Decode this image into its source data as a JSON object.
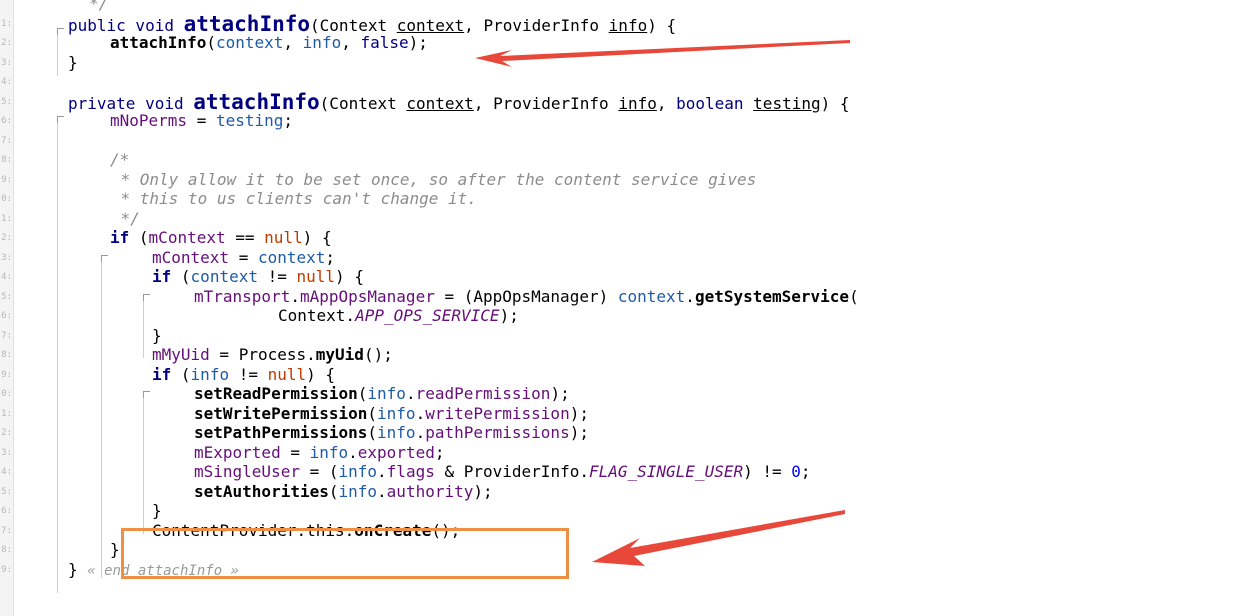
{
  "gutter": {
    "line_numbers": [
      "",
      "1:",
      "2:",
      "3:",
      "4:",
      "5:",
      "6:",
      "7:",
      "8:",
      "9:",
      "0:",
      "1:",
      "2:",
      "3:",
      "4:",
      "5:",
      "6:",
      "7:",
      "8:",
      "9:",
      "0:",
      "1:",
      "2:",
      "3:",
      "4:",
      "5:",
      "6:",
      "7:",
      "8:",
      "9:"
    ]
  },
  "editor": {
    "lines": [
      {
        "indent": 2,
        "tokens": [
          {
            "t": "*/",
            "c": "cmt"
          }
        ]
      },
      {
        "indent": 0,
        "tokens": [
          {
            "t": "public void ",
            "c": "kw"
          },
          {
            "t": "attachInfo",
            "c": "decl"
          },
          {
            "t": "(Context ",
            "c": "type"
          },
          {
            "t": "context",
            "c": "param"
          },
          {
            "t": ", ProviderInfo ",
            "c": "type"
          },
          {
            "t": "info",
            "c": "param"
          },
          {
            "t": ") {",
            "c": "type"
          }
        ]
      },
      {
        "indent": 4,
        "tokens": [
          {
            "t": "attachInfo",
            "c": "call"
          },
          {
            "t": "(",
            "c": "type"
          },
          {
            "t": "context",
            "c": "var"
          },
          {
            "t": ", ",
            "c": "type"
          },
          {
            "t": "info",
            "c": "var"
          },
          {
            "t": ", ",
            "c": "type"
          },
          {
            "t": "false",
            "c": "kw"
          },
          {
            "t": ");",
            "c": "type"
          }
        ]
      },
      {
        "indent": 0,
        "tokens": [
          {
            "t": "}",
            "c": "type"
          }
        ]
      },
      {
        "indent": 0,
        "tokens": []
      },
      {
        "indent": 0,
        "tokens": [
          {
            "t": "private void ",
            "c": "kw"
          },
          {
            "t": "attachInfo",
            "c": "decl"
          },
          {
            "t": "(Context ",
            "c": "type"
          },
          {
            "t": "context",
            "c": "param"
          },
          {
            "t": ", ProviderInfo ",
            "c": "type"
          },
          {
            "t": "info",
            "c": "param"
          },
          {
            "t": ", ",
            "c": "type"
          },
          {
            "t": "boolean ",
            "c": "kw"
          },
          {
            "t": "testing",
            "c": "param"
          },
          {
            "t": ") {",
            "c": "type"
          }
        ]
      },
      {
        "indent": 4,
        "tokens": [
          {
            "t": "mNoPerms",
            "c": "field"
          },
          {
            "t": " = ",
            "c": "type"
          },
          {
            "t": "testing",
            "c": "var"
          },
          {
            "t": ";",
            "c": "type"
          }
        ]
      },
      {
        "indent": 0,
        "tokens": []
      },
      {
        "indent": 4,
        "tokens": [
          {
            "t": "/*",
            "c": "cmt"
          }
        ]
      },
      {
        "indent": 5,
        "tokens": [
          {
            "t": "* Only allow it to be set once, so after the content service gives",
            "c": "cmt"
          }
        ]
      },
      {
        "indent": 5,
        "tokens": [
          {
            "t": "* this to us clients can't change it.",
            "c": "cmt"
          }
        ]
      },
      {
        "indent": 5,
        "tokens": [
          {
            "t": "*/",
            "c": "cmt"
          }
        ]
      },
      {
        "indent": 4,
        "tokens": [
          {
            "t": "if ",
            "c": "kwb"
          },
          {
            "t": "(",
            "c": "type"
          },
          {
            "t": "mContext",
            "c": "field"
          },
          {
            "t": " == ",
            "c": "type"
          },
          {
            "t": "null",
            "c": "null"
          },
          {
            "t": ") {",
            "c": "type"
          }
        ]
      },
      {
        "indent": 8,
        "tokens": [
          {
            "t": "mContext",
            "c": "field"
          },
          {
            "t": " = ",
            "c": "type"
          },
          {
            "t": "context",
            "c": "var"
          },
          {
            "t": ";",
            "c": "type"
          }
        ]
      },
      {
        "indent": 8,
        "tokens": [
          {
            "t": "if ",
            "c": "kwb"
          },
          {
            "t": "(",
            "c": "type"
          },
          {
            "t": "context",
            "c": "var"
          },
          {
            "t": " != ",
            "c": "type"
          },
          {
            "t": "null",
            "c": "null"
          },
          {
            "t": ") {",
            "c": "type"
          }
        ]
      },
      {
        "indent": 12,
        "tokens": [
          {
            "t": "mTransport",
            "c": "field"
          },
          {
            "t": ".",
            "c": "type"
          },
          {
            "t": "mAppOpsManager",
            "c": "field"
          },
          {
            "t": " = (AppOpsManager) ",
            "c": "type"
          },
          {
            "t": "context",
            "c": "var"
          },
          {
            "t": ".",
            "c": "type"
          },
          {
            "t": "getSystemService",
            "c": "call"
          },
          {
            "t": "(",
            "c": "type"
          }
        ]
      },
      {
        "indent": 20,
        "tokens": [
          {
            "t": "Context.",
            "c": "type"
          },
          {
            "t": "APP_OPS_SERVICE",
            "c": "fstatic"
          },
          {
            "t": ");",
            "c": "type"
          }
        ]
      },
      {
        "indent": 8,
        "tokens": [
          {
            "t": "}",
            "c": "type"
          }
        ]
      },
      {
        "indent": 8,
        "tokens": [
          {
            "t": "mMyUid",
            "c": "field"
          },
          {
            "t": " = Process.",
            "c": "type"
          },
          {
            "t": "myUid",
            "c": "call"
          },
          {
            "t": "();",
            "c": "type"
          }
        ]
      },
      {
        "indent": 8,
        "tokens": [
          {
            "t": "if ",
            "c": "kwb"
          },
          {
            "t": "(",
            "c": "type"
          },
          {
            "t": "info",
            "c": "var"
          },
          {
            "t": " != ",
            "c": "type"
          },
          {
            "t": "null",
            "c": "null"
          },
          {
            "t": ") {",
            "c": "type"
          }
        ]
      },
      {
        "indent": 12,
        "tokens": [
          {
            "t": "setReadPermission",
            "c": "call"
          },
          {
            "t": "(",
            "c": "type"
          },
          {
            "t": "info",
            "c": "var"
          },
          {
            "t": ".",
            "c": "type"
          },
          {
            "t": "readPermission",
            "c": "field"
          },
          {
            "t": ");",
            "c": "type"
          }
        ]
      },
      {
        "indent": 12,
        "tokens": [
          {
            "t": "setWritePermission",
            "c": "call"
          },
          {
            "t": "(",
            "c": "type"
          },
          {
            "t": "info",
            "c": "var"
          },
          {
            "t": ".",
            "c": "type"
          },
          {
            "t": "writePermission",
            "c": "field"
          },
          {
            "t": ");",
            "c": "type"
          }
        ]
      },
      {
        "indent": 12,
        "tokens": [
          {
            "t": "setPathPermissions",
            "c": "call"
          },
          {
            "t": "(",
            "c": "type"
          },
          {
            "t": "info",
            "c": "var"
          },
          {
            "t": ".",
            "c": "type"
          },
          {
            "t": "pathPermissions",
            "c": "field"
          },
          {
            "t": ");",
            "c": "type"
          }
        ]
      },
      {
        "indent": 12,
        "tokens": [
          {
            "t": "mExported",
            "c": "field"
          },
          {
            "t": " = ",
            "c": "type"
          },
          {
            "t": "info",
            "c": "var"
          },
          {
            "t": ".",
            "c": "type"
          },
          {
            "t": "exported",
            "c": "field"
          },
          {
            "t": ";",
            "c": "type"
          }
        ]
      },
      {
        "indent": 12,
        "tokens": [
          {
            "t": "mSingleUser",
            "c": "field"
          },
          {
            "t": " = (",
            "c": "type"
          },
          {
            "t": "info",
            "c": "var"
          },
          {
            "t": ".",
            "c": "type"
          },
          {
            "t": "flags",
            "c": "field"
          },
          {
            "t": " & ProviderInfo.",
            "c": "type"
          },
          {
            "t": "FLAG_SINGLE_USER",
            "c": "fstatic"
          },
          {
            "t": ") != ",
            "c": "type"
          },
          {
            "t": "0",
            "c": "num"
          },
          {
            "t": ";",
            "c": "type"
          }
        ]
      },
      {
        "indent": 12,
        "tokens": [
          {
            "t": "setAuthorities",
            "c": "call"
          },
          {
            "t": "(",
            "c": "type"
          },
          {
            "t": "info",
            "c": "var"
          },
          {
            "t": ".",
            "c": "type"
          },
          {
            "t": "authority",
            "c": "field"
          },
          {
            "t": ");",
            "c": "type"
          }
        ]
      },
      {
        "indent": 8,
        "tokens": [
          {
            "t": "}",
            "c": "type"
          }
        ]
      },
      {
        "indent": 8,
        "tokens": [
          {
            "t": "ContentProvider.this.",
            "c": "type"
          },
          {
            "t": "onCreate",
            "c": "call"
          },
          {
            "t": "();",
            "c": "type"
          }
        ]
      },
      {
        "indent": 4,
        "tokens": [
          {
            "t": "}",
            "c": "type"
          }
        ]
      },
      {
        "indent": 0,
        "tokens": [
          {
            "t": "} ",
            "c": "type"
          },
          {
            "t": "« end attachInfo »",
            "c": "fold"
          }
        ]
      }
    ]
  },
  "annotations": {
    "arrow_color": "#e8483a",
    "box_color": "#ef8f43"
  }
}
